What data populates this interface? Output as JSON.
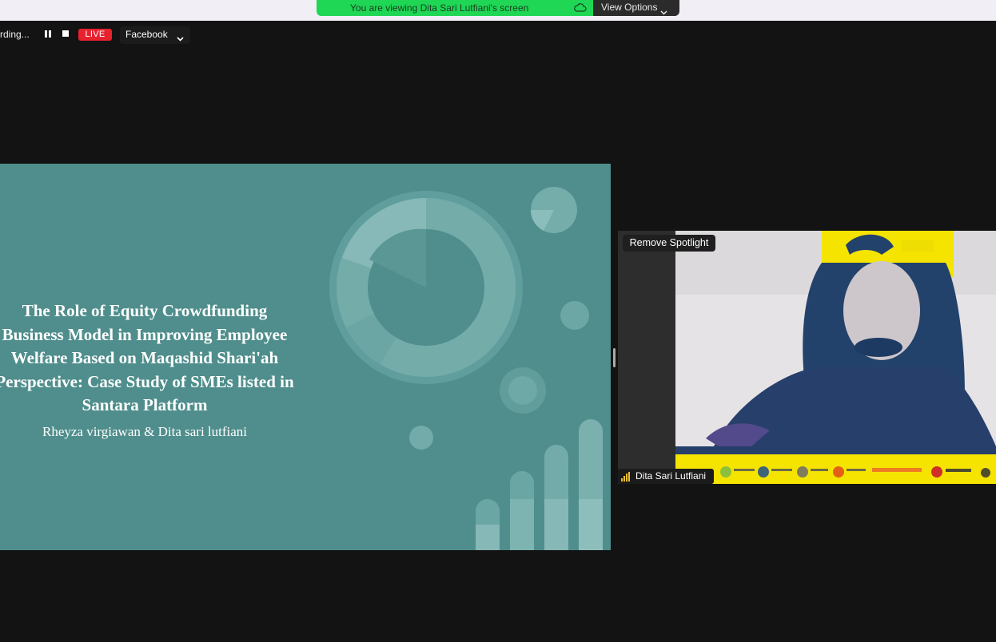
{
  "share_banner": {
    "viewing_text": "You are viewing Dita Sari Lutfiani's screen",
    "view_options_label": "View Options"
  },
  "recording_bar": {
    "status_text": "rding...",
    "live_label": "LIVE",
    "stream_target": "Facebook"
  },
  "slide": {
    "title_lines": [
      "The Role of Equity Crowdfunding",
      "Business Model in Improving Employee",
      "Welfare Based on Maqashid Shari'ah",
      "Perspective: Case Study of SMEs listed in",
      "Santara Platform"
    ],
    "authors": "Rheyza virgiawan & Dita sari lutfiani",
    "background_color": "#4f8e8c"
  },
  "spotlight": {
    "remove_label": "Remove Spotlight",
    "participant_name": "Dita Sari Lutfiani",
    "signal_color": "#f2c12e"
  },
  "colors": {
    "banner_green": "#1fd655",
    "live_red": "#e8212f",
    "video_banner_yellow": "#f5e400"
  }
}
